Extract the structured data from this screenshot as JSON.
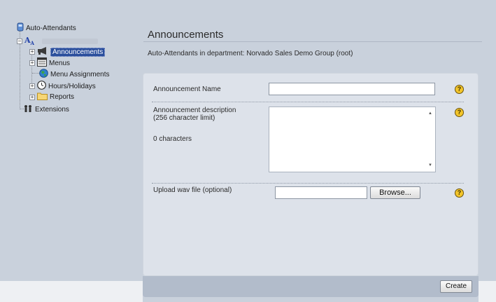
{
  "sidebar": {
    "root_label": "Auto-Attendants",
    "items": [
      {
        "label": "Announcements",
        "icon": "megaphone-icon",
        "selected": true
      },
      {
        "label": "Menus",
        "icon": "menu-icon"
      },
      {
        "label": "Menu Assignments",
        "icon": "globe-icon"
      },
      {
        "label": "Hours/Holidays",
        "icon": "clock-icon"
      },
      {
        "label": "Reports",
        "icon": "folder-icon"
      }
    ],
    "extensions_label": "Extensions"
  },
  "main": {
    "title": "Announcements",
    "subtitle": "Auto-Attendants in department: Norvado Sales Demo Group (root)"
  },
  "form": {
    "name_label": "Announcement Name",
    "name_value": "",
    "desc_label_line1": "Announcement description",
    "desc_label_line2": "(256 character limit)",
    "char_count": "0 characters",
    "desc_value": "",
    "upload_label": "Upload wav file (optional)",
    "upload_value": "",
    "browse_label": "Browse...",
    "help_glyph": "?"
  },
  "footer": {
    "create_label": "Create"
  },
  "colors": {
    "selection": "#2a4e9c",
    "help": "#f3c52a",
    "background": "#c9d1dc"
  }
}
